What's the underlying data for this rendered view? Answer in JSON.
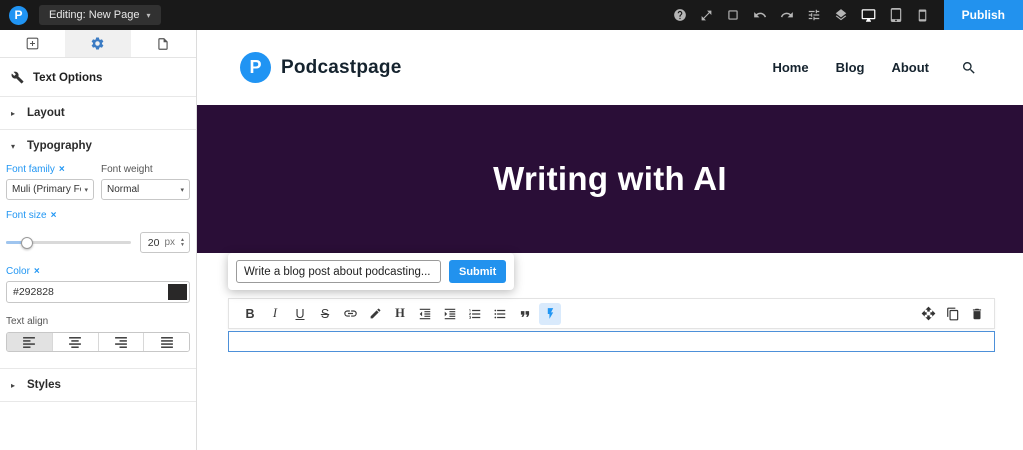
{
  "glyphs": {
    "caret_down": "▾",
    "chevron_right": "▸",
    "chevron_down": "▾",
    "clear": "×",
    "spinner_up": "▲",
    "spinner_down": "▼"
  },
  "topbar": {
    "logo_letter": "P",
    "editing_label": "Editing: New Page",
    "publish_label": "Publish",
    "tool_icons": [
      "help",
      "fullscreen",
      "preview-frame",
      "undo",
      "redo",
      "sliders",
      "layers"
    ],
    "device_icons": [
      "desktop",
      "tablet",
      "mobile"
    ],
    "active_device": "desktop"
  },
  "sidebar": {
    "tabs": [
      "add-elements",
      "settings",
      "page"
    ],
    "active_tab": "settings",
    "title": "Text Options",
    "sections": {
      "layout": "Layout",
      "typography": "Typography",
      "styles": "Styles"
    },
    "typography": {
      "font_family_label": "Font family",
      "font_family_value": "Muli (Primary Font)",
      "font_weight_label": "Font weight",
      "font_weight_value": "Normal",
      "font_size_label": "Font size",
      "font_size_value": "20",
      "font_size_unit": "px",
      "color_label": "Color",
      "color_value": "#292828",
      "swatch_style": "background:#292828",
      "text_align_label": "Text align",
      "text_align_active": "left"
    }
  },
  "site": {
    "logo_letter": "P",
    "name": "Podcastpage",
    "nav": [
      "Home",
      "Blog",
      "About"
    ],
    "hero_title": "Writing with AI"
  },
  "ai_prompt": {
    "input_value": "Write a blog post about podcasting...",
    "submit_label": "Submit"
  },
  "editor_toolbar": {
    "glyphs": {
      "bold": "B",
      "italic": "I",
      "underline": "U",
      "strikethrough": "S",
      "heading": "H"
    },
    "buttons": [
      "bold",
      "italic",
      "underline",
      "strikethrough",
      "link",
      "text-color",
      "heading",
      "outdent",
      "indent",
      "numbered-list",
      "bulleted-list",
      "quote",
      "ai-writer"
    ],
    "element_controls": [
      "move",
      "duplicate",
      "delete"
    ]
  },
  "colors": {
    "accent_blue": "#2292ee",
    "label_blue": "#2196f3",
    "hero_background": "#2a0e37",
    "topbar_background": "#191919",
    "selection_border": "#4d90d9",
    "swatch": "#292828"
  }
}
